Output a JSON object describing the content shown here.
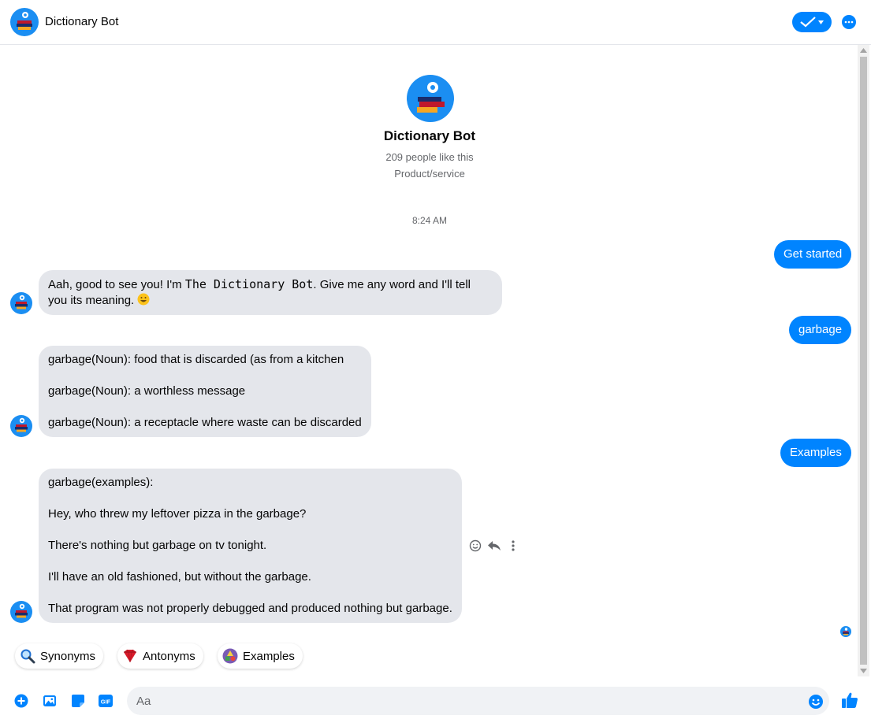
{
  "header": {
    "title": "Dictionary Bot"
  },
  "profile": {
    "name": "Dictionary Bot",
    "likes": "209 people like this",
    "category": "Product/service"
  },
  "timestamp": "8:24 AM",
  "messages": {
    "out_get_started": "Get started",
    "in_welcome_1": "Aah, good to see you! I'm ",
    "in_welcome_mono": "The Dictionary Bot",
    "in_welcome_2": ". Give me any word and I'll tell",
    "in_welcome_3": "you its meaning. ",
    "out_garbage": "garbage",
    "in_def_1": "garbage(Noun): food that is discarded (as from a kitchen",
    "in_def_2": "garbage(Noun): a worthless message",
    "in_def_3": "garbage(Noun): a receptacle where waste can be discarded",
    "out_examples": "Examples",
    "in_ex_0": "garbage(examples):",
    "in_ex_1": "Hey, who threw my leftover pizza in the garbage?",
    "in_ex_2": "There's nothing but garbage on tv tonight.",
    "in_ex_3": "I'll have an old fashioned, but without the garbage.",
    "in_ex_4": "That program was not properly debugged and produced nothing but garbage."
  },
  "quick_replies": [
    {
      "label": "Synonyms",
      "icon": "magnifier-icon"
    },
    {
      "label": "Antonyms",
      "icon": "heart-icon"
    },
    {
      "label": "Examples",
      "icon": "blocks-icon"
    }
  ],
  "composer": {
    "placeholder": "Aa"
  },
  "colors": {
    "accent": "#0084ff",
    "incoming_bubble": "#e4e6eb",
    "input_bg": "#f0f2f5"
  }
}
